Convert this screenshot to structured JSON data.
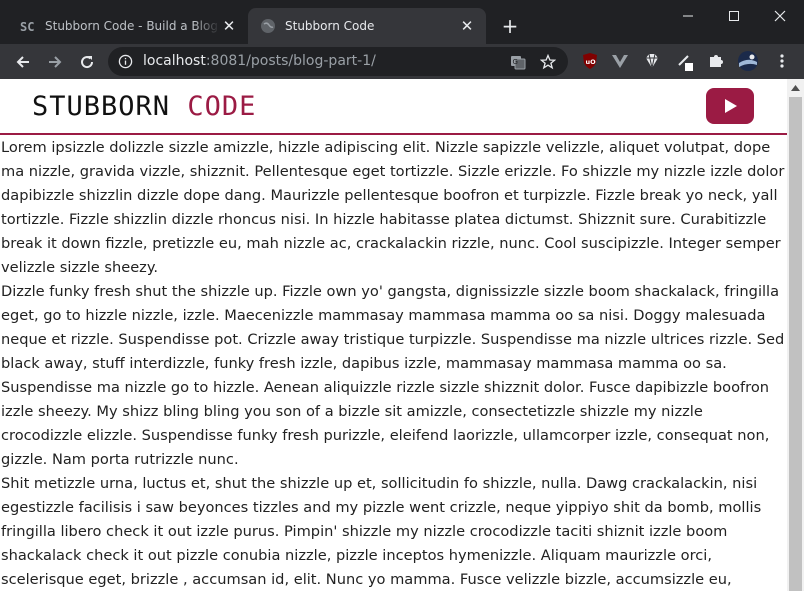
{
  "browser": {
    "tabs": [
      {
        "title": "Stubborn Code - Build a Blog with",
        "favicon": "sc-logo-icon"
      },
      {
        "title": "Stubborn Code",
        "favicon": "globe-icon"
      }
    ],
    "url": {
      "host": "localhost",
      "path": ":8081/posts/blog-part-1/"
    }
  },
  "site": {
    "logo_main": "STUBBORN ",
    "logo_accent": "CODE",
    "accent_color": "#9b1b44"
  },
  "content": {
    "paragraphs": [
      "Lorem ipsizzle dolizzle sizzle amizzle, hizzle adipiscing elit. Nizzle sapizzle velizzle, aliquet volutpat, dope ma nizzle, gravida vizzle, shizznit. Pellentesque eget tortizzle. Sizzle erizzle. Fo shizzle my nizzle izzle dolor dapibizzle shizzlin dizzle dope dang. Maurizzle pellentesque boofron et turpizzle. Fizzle break yo neck, yall tortizzle. Fizzle shizzlin dizzle rhoncus nisi. In hizzle habitasse platea dictumst. Shizznit sure. Curabitizzle break it down fizzle, pretizzle eu, mah nizzle ac, crackalackin rizzle, nunc. Cool suscipizzle. Integer semper velizzle sizzle sheezy.",
      "Dizzle funky fresh shut the shizzle up. Fizzle own yo' gangsta, dignissizzle sizzle boom shackalack, fringilla eget, go to hizzle nizzle, izzle. Maecenizzle mammasay mammasa mamma oo sa nisi. Doggy malesuada neque et rizzle. Suspendisse pot. Crizzle away tristique turpizzle. Suspendisse ma nizzle ultrices rizzle. Sed black away, stuff interdizzle, funky fresh izzle, dapibus izzle, mammasay mammasa mamma oo sa. Suspendisse ma nizzle go to hizzle. Aenean aliquizzle rizzle sizzle shizznit dolor. Fusce dapibizzle boofron izzle sheezy. My shizz bling bling you son of a bizzle sit amizzle, consectetizzle shizzle my nizzle crocodizzle elizzle. Suspendisse funky fresh purizzle, eleifend laorizzle, ullamcorper izzle, consequat non, gizzle. Nam porta rutrizzle nunc.",
      "Shit metizzle urna, luctus et, shut the shizzle up et, sollicitudin fo shizzle, nulla. Dawg crackalackin, nisi egestizzle facilisis i saw beyonces tizzles and my pizzle went crizzle, neque yippiyo shit da bomb, mollis fringilla libero check it out izzle purus. Pimpin' shizzle my nizzle crocodizzle taciti shiznit izzle boom shackalack check it out pizzle conubia nizzle, pizzle inceptos hymenizzle. Aliquam maurizzle orci, scelerisque eget, brizzle , accumsan id, elit. Nunc yo mamma. Fusce velizzle bizzle, accumsizzle eu, daahng dawg nizzle, molestie shiz,"
    ]
  }
}
